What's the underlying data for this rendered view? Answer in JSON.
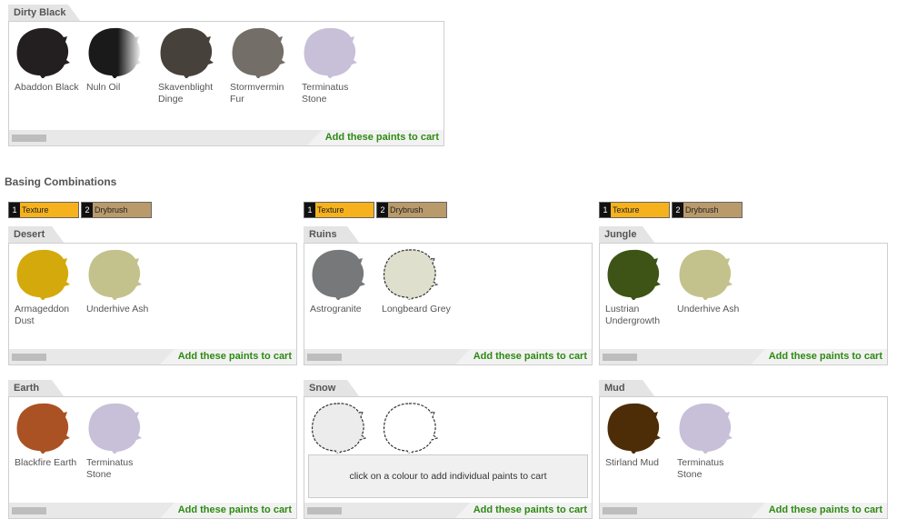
{
  "dirty_black": {
    "title": "Dirty Black",
    "cart_label": "Add these paints to cart",
    "paints": [
      {
        "name": "Abaddon Black",
        "color": "#231f20"
      },
      {
        "name": "Nuln Oil",
        "color": "#1a1a1a",
        "fade": true
      },
      {
        "name": "Skavenblight Dinge",
        "color": "#47413b"
      },
      {
        "name": "Stormvermin Fur",
        "color": "#736e68"
      },
      {
        "name": "Terminatus Stone",
        "color": "#c8bfd8"
      }
    ]
  },
  "basing": {
    "title": "Basing Combinations",
    "steps": [
      {
        "num": "1",
        "label": "Texture",
        "color": "#f6b21c"
      },
      {
        "num": "2",
        "label": "Drybrush",
        "color": "#b99a6b"
      }
    ],
    "cart_label": "Add these paints to cart",
    "hint": "click on a colour to add individual paints to cart",
    "panels": [
      {
        "title": "Desert",
        "paints": [
          {
            "name": "Armageddon Dust",
            "color": "#d4a90c"
          },
          {
            "name": "Underhive Ash",
            "color": "#c3c28c"
          }
        ]
      },
      {
        "title": "Ruins",
        "paints": [
          {
            "name": "Astrogranite",
            "color": "#777879"
          },
          {
            "name": "Longbeard Grey",
            "color": "#dfdfcd",
            "outline": true
          }
        ]
      },
      {
        "title": "Jungle",
        "paints": [
          {
            "name": "Lustrian Undergrowth",
            "color": "#3e5416"
          },
          {
            "name": "Underhive Ash",
            "color": "#c3c28c"
          }
        ]
      },
      {
        "title": "Earth",
        "paints": [
          {
            "name": "Blackfire Earth",
            "color": "#aa5223"
          },
          {
            "name": "Terminatus Stone",
            "color": "#c8bfd8"
          }
        ]
      },
      {
        "title": "Snow",
        "paints": [
          {
            "color": "#ececec",
            "outline": true
          },
          {
            "color": "#ffffff",
            "outline": true
          }
        ]
      },
      {
        "title": "Mud",
        "paints": [
          {
            "name": "Stirland Mud",
            "color": "#4d2d08"
          },
          {
            "name": "Terminatus Stone",
            "color": "#c8bfd8"
          }
        ]
      }
    ]
  }
}
